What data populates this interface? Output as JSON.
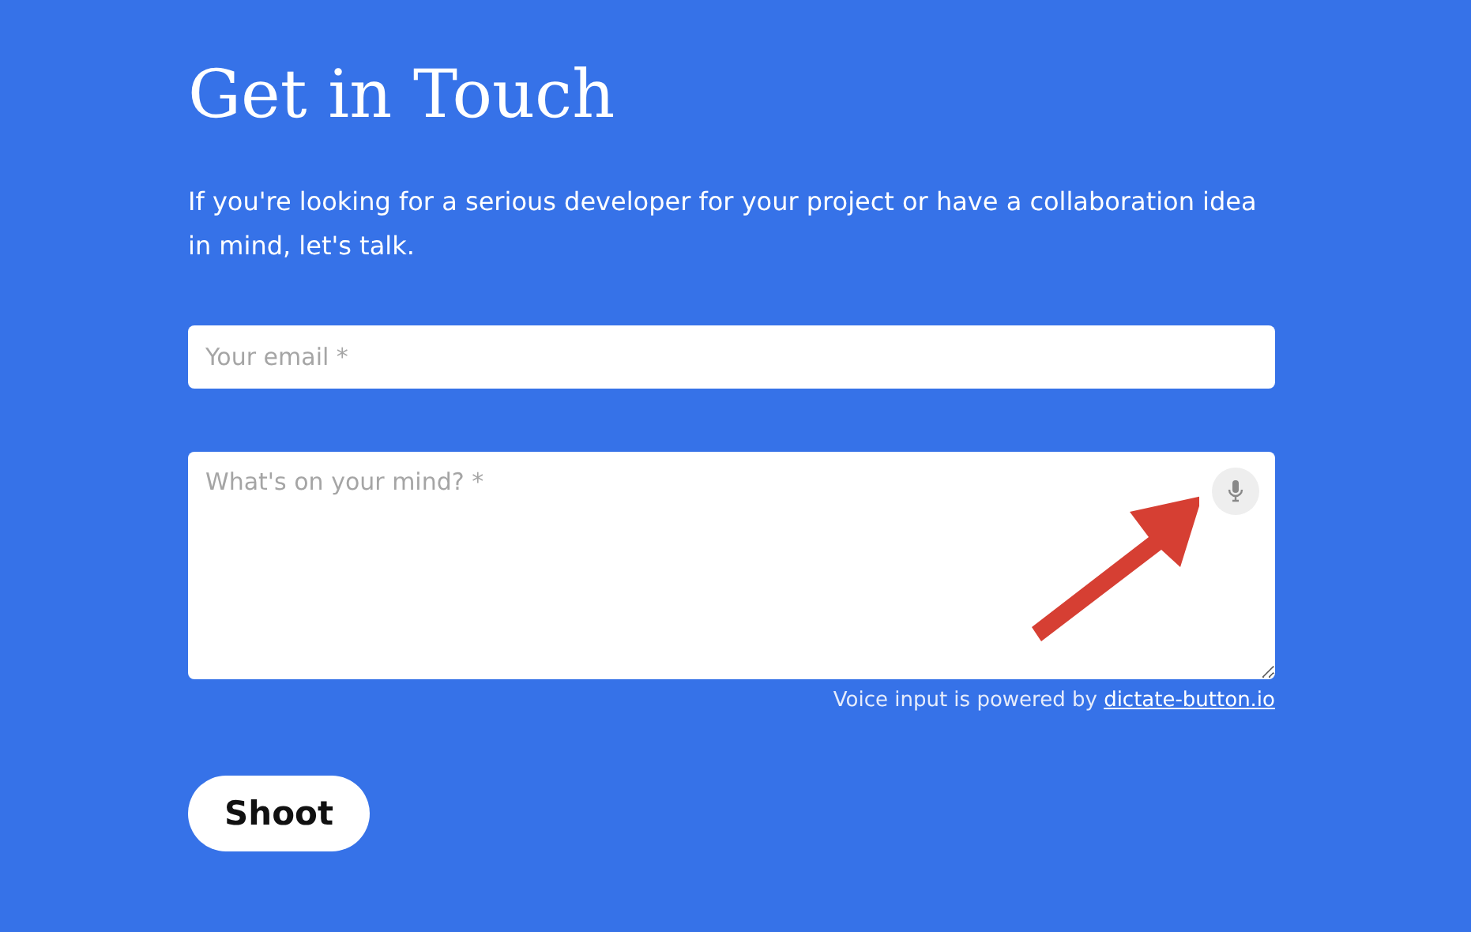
{
  "title": "Get in Touch",
  "intro": "If you're looking for a serious developer for your project or have a collaboration idea in mind, let's talk.",
  "email": {
    "placeholder": "Your email *"
  },
  "message": {
    "placeholder": "What's on your mind? *"
  },
  "voice_note": {
    "text": "Voice input is powered by",
    "link": "dictate-button.io"
  },
  "submit": "Shoot"
}
